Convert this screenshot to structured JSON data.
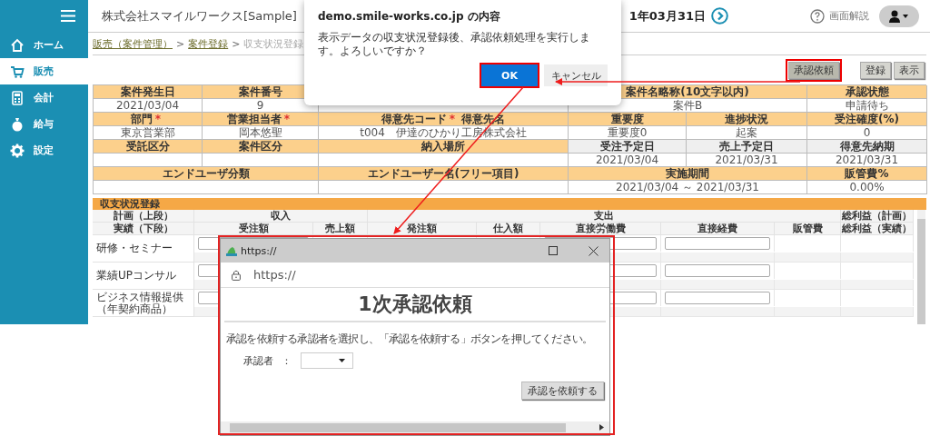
{
  "sidebar": {
    "items": [
      {
        "label": "ホーム",
        "selected": false
      },
      {
        "label": "販売",
        "selected": true
      },
      {
        "label": "会計",
        "selected": false
      },
      {
        "label": "給与",
        "selected": false
      },
      {
        "label": "設定",
        "selected": false
      }
    ]
  },
  "header": {
    "company": "株式会社スマイルワークス[Sample]",
    "date": "1年03月31日",
    "help": "画面解説"
  },
  "breadcrumb": [
    {
      "label": "販売（案件管理）",
      "link": true
    },
    {
      "label": "案件登録",
      "link": true
    },
    {
      "label": "収支状況登録",
      "link": false
    }
  ],
  "breadcrumb_separator": ">",
  "actions": [
    {
      "label": "承認依頼",
      "highlighted": true
    },
    {
      "label": "登録",
      "highlighted": false
    },
    {
      "label": "表示",
      "highlighted": false
    }
  ],
  "info_table": {
    "rows": [
      {
        "cells": [
          {
            "kind": "head",
            "text": "案件発生日"
          },
          {
            "kind": "head",
            "text": "案件番号"
          },
          {
            "kind": "head"
          },
          {
            "kind": "head",
            "text": "案件名略称(10文字以内)",
            "colspan": 2
          },
          {
            "kind": "head",
            "text": "承認状態"
          }
        ]
      },
      {
        "cells": [
          {
            "kind": "value",
            "text": "2021/03/04"
          },
          {
            "kind": "value",
            "text": "9"
          },
          {
            "kind": "value"
          },
          {
            "kind": "value",
            "text": "案件B",
            "colspan": 2
          },
          {
            "kind": "value",
            "text": "申請待ち"
          }
        ]
      },
      {
        "cells": [
          {
            "kind": "head",
            "text": "部門",
            "mark": "*"
          },
          {
            "kind": "head",
            "text": "営業担当者",
            "mark": "*"
          },
          {
            "kind": "head",
            "text": "得意先コード",
            "mark": "*",
            "suffix": "得意先名"
          },
          {
            "kind": "head",
            "text": "重要度"
          },
          {
            "kind": "head",
            "text": "進捗状況"
          },
          {
            "kind": "head",
            "text": "受注確度(%)"
          }
        ]
      },
      {
        "cells": [
          {
            "kind": "value",
            "text": "東京営業部"
          },
          {
            "kind": "value",
            "text": "岡本悠聖"
          },
          {
            "kind": "value",
            "text": "t004　伊達のひかり工房株式会社"
          },
          {
            "kind": "value",
            "text": "重要度0"
          },
          {
            "kind": "value",
            "text": "起案"
          },
          {
            "kind": "value",
            "text": "0"
          }
        ]
      },
      {
        "cells": [
          {
            "kind": "head",
            "text": "受託区分"
          },
          {
            "kind": "head",
            "text": "案件区分"
          },
          {
            "kind": "head",
            "text": "納入場所"
          },
          {
            "kind": "subhead",
            "text": "受注予定日"
          },
          {
            "kind": "subhead",
            "text": "売上予定日"
          },
          {
            "kind": "subhead",
            "text": "得意先納期"
          }
        ]
      },
      {
        "cells": [
          {
            "kind": "value"
          },
          {
            "kind": "value"
          },
          {
            "kind": "value"
          },
          {
            "kind": "value",
            "text": "2021/03/04"
          },
          {
            "kind": "value",
            "text": "2021/03/31"
          },
          {
            "kind": "value",
            "text": "2021/03/31"
          }
        ]
      },
      {
        "cells": [
          {
            "kind": "head",
            "text": "エンドユーザ分類",
            "colspan": 2
          },
          {
            "kind": "head",
            "text": "エンドユーザー名(フリー項目)"
          },
          {
            "kind": "head",
            "text": "実施期間",
            "colspan": 2
          },
          {
            "kind": "head",
            "text": "販管費%"
          }
        ]
      },
      {
        "cells": [
          {
            "kind": "value",
            "colspan": 2
          },
          {
            "kind": "value"
          },
          {
            "kind": "value",
            "text": "2021/03/04 ～ 2021/03/31",
            "colspan": 2
          },
          {
            "kind": "value",
            "text": "0.00%"
          }
        ]
      }
    ]
  },
  "ledger": {
    "title": "収支状況登録",
    "plan_label": "計画（上段）",
    "actual_label": "実績（下段）",
    "income": "収入",
    "expense": "支出",
    "profit_plan": "総利益（計画）",
    "profit_actual": "総利益（実績）",
    "columns": [
      {
        "label": "受注額",
        "input": true
      },
      {
        "label": "売上額",
        "input": false
      },
      {
        "label": "発注額",
        "input": false
      },
      {
        "label": "仕入額",
        "input": false
      },
      {
        "label": "直接労働費",
        "input": true
      },
      {
        "label": "直接経費",
        "input": true
      },
      {
        "label": "販管費",
        "input": false
      }
    ],
    "rows": [
      {
        "label": "研修・セミナー"
      },
      {
        "label": "業績UPコンサル"
      },
      {
        "label": "ビジネス情報提供（年契約商品）"
      }
    ]
  },
  "dialog": {
    "title": "demo.smile-works.co.jp の内容",
    "message": "表示データの収支状況登録後、承認依頼処理を実行します。よろしいですか？",
    "ok": "OK",
    "cancel": "キャンセル",
    "ok_highlighted": true
  },
  "popup": {
    "title": "https://",
    "address": "https://",
    "heading": "1次承認依頼",
    "instruction": "承認を依頼する承認者を選択し、「承認を依頼する」ボタンを押してください。",
    "approver_label": "承認者",
    "separator": "：",
    "submit": "承認を依頼する",
    "highlighted": true
  }
}
